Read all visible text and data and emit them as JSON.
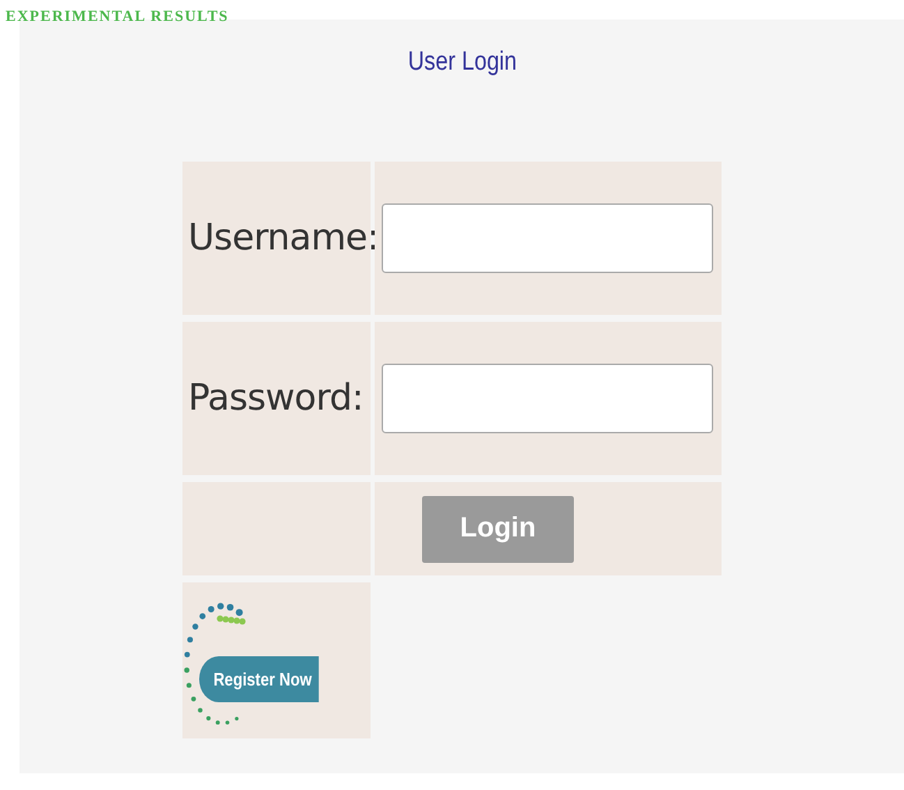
{
  "page_heading": "EXPERIMENTAL RESULTS",
  "title": "User Login",
  "fields": [
    {
      "label": "Username:"
    },
    {
      "label": "Password:"
    }
  ],
  "login_button": "Login",
  "register_link": "Register Now"
}
